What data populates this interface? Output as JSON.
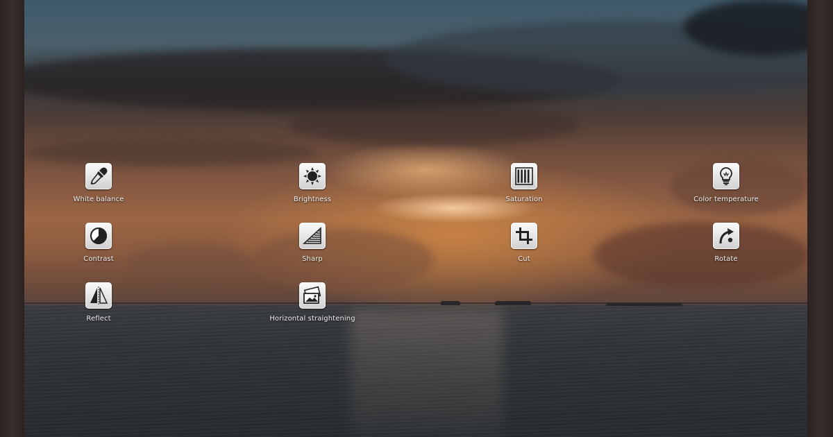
{
  "tools": [
    {
      "label": "White balance",
      "icon": "eyedropper-icon"
    },
    {
      "label": "Brightness",
      "icon": "sun-icon"
    },
    {
      "label": "Saturation",
      "icon": "vertical-bars-icon"
    },
    {
      "label": "Color temperature",
      "icon": "lightbulb-icon"
    },
    {
      "label": "Contrast",
      "icon": "contrast-circle-icon"
    },
    {
      "label": "Sharp",
      "icon": "sharpness-triangle-icon"
    },
    {
      "label": "Cut",
      "icon": "crop-icon"
    },
    {
      "label": "Rotate",
      "icon": "rotate-arrow-icon"
    },
    {
      "label": "Reflect",
      "icon": "mirror-icon"
    },
    {
      "label": "Horizontal straightening",
      "icon": "straighten-photos-icon"
    }
  ]
}
